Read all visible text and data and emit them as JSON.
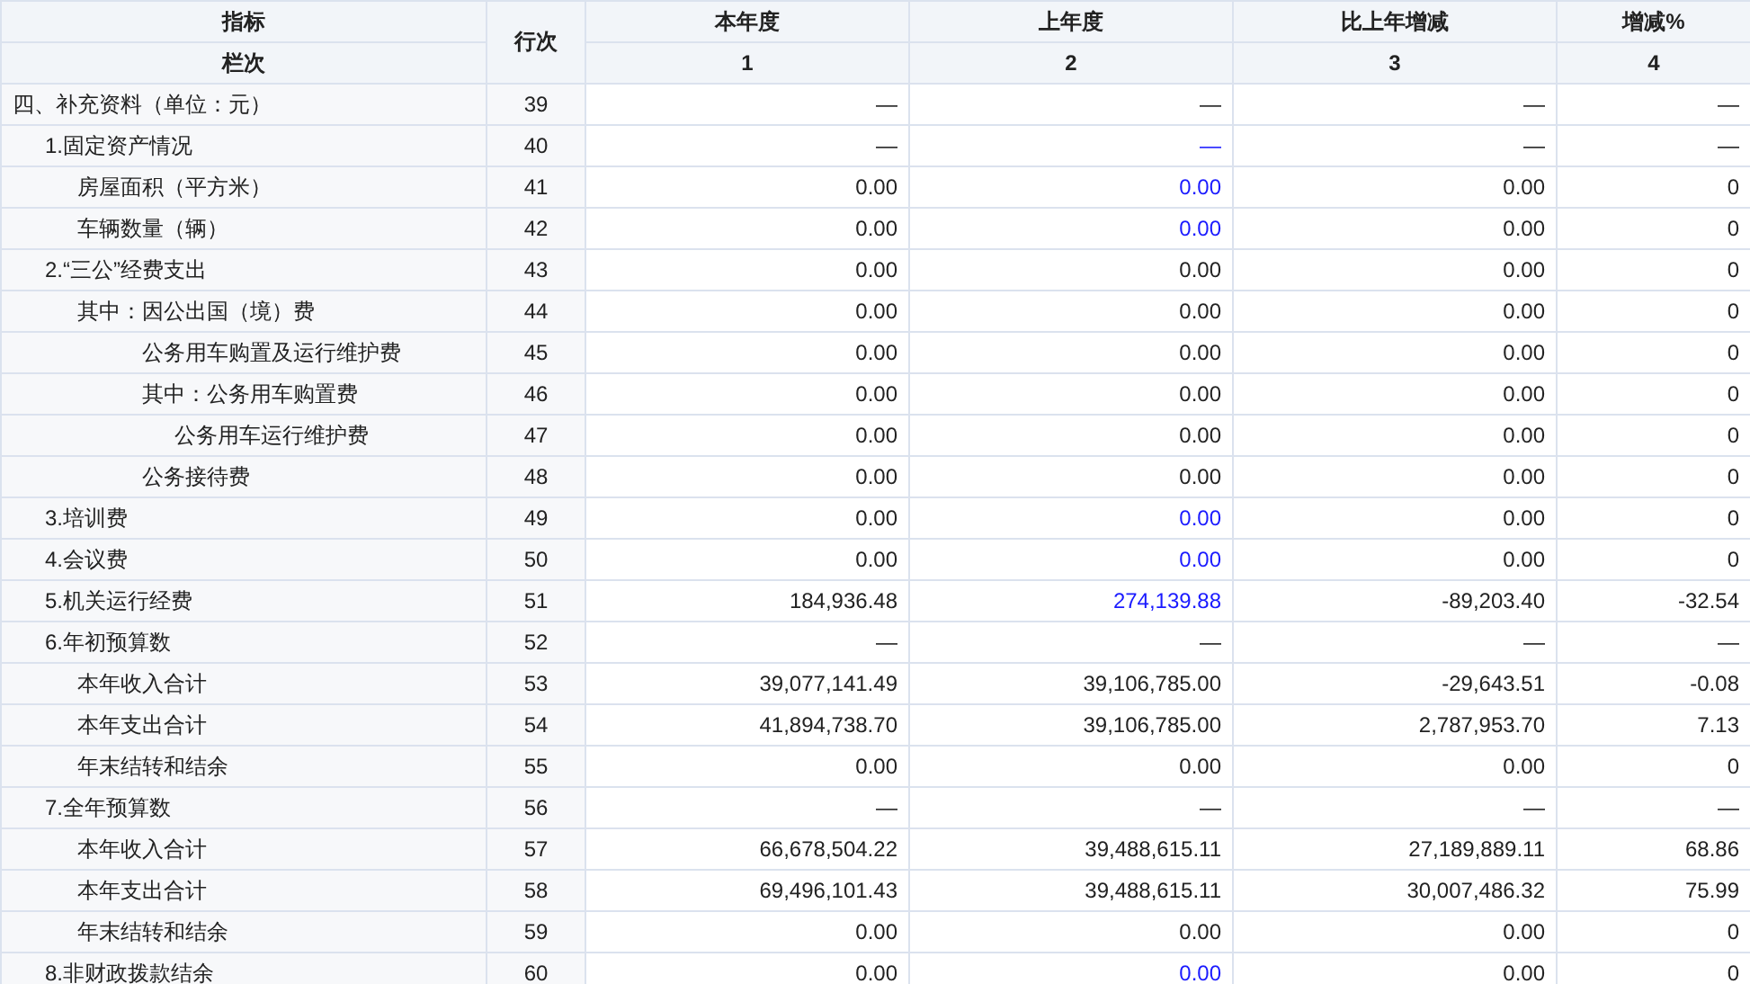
{
  "table": {
    "columns": [
      {
        "title": "指标",
        "code": "栏次"
      },
      {
        "title": "行次"
      },
      {
        "title": "本年度",
        "code": "1"
      },
      {
        "title": "上年度",
        "code": "2"
      },
      {
        "title": "比上年增减",
        "code": "3"
      },
      {
        "title": "增减%",
        "code": "4"
      }
    ],
    "rows": [
      {
        "label": "四、补充资料（单位：元）",
        "line": "39",
        "values": [
          "—",
          "—",
          "—",
          "—"
        ],
        "prior_year_linked": false,
        "children": [
          {
            "label": "1.固定资产情况",
            "line": "40",
            "values": [
              "—",
              "—",
              "—",
              "—"
            ],
            "prior_year_linked": true,
            "children": [
              {
                "label": "房屋面积（平方米）",
                "line": "41",
                "values": [
                  "0.00",
                  "0.00",
                  "0.00",
                  "0"
                ],
                "prior_year_linked": true
              },
              {
                "label": "车辆数量（辆）",
                "line": "42",
                "values": [
                  "0.00",
                  "0.00",
                  "0.00",
                  "0"
                ],
                "prior_year_linked": true
              }
            ]
          },
          {
            "label": "2.“三公”经费支出",
            "line": "43",
            "values": [
              "0.00",
              "0.00",
              "0.00",
              "0"
            ],
            "prior_year_linked": false,
            "children": [
              {
                "label": "其中：因公出国（境）费",
                "line": "44",
                "values": [
                  "0.00",
                  "0.00",
                  "0.00",
                  "0"
                ],
                "prior_year_linked": false,
                "children": [
                  {
                    "label": "公务用车购置及运行维护费",
                    "line": "45",
                    "values": [
                      "0.00",
                      "0.00",
                      "0.00",
                      "0"
                    ],
                    "prior_year_linked": false
                  },
                  {
                    "label": "其中：公务用车购置费",
                    "line": "46",
                    "values": [
                      "0.00",
                      "0.00",
                      "0.00",
                      "0"
                    ],
                    "prior_year_linked": false,
                    "children": [
                      {
                        "label": "公务用车运行维护费",
                        "line": "47",
                        "values": [
                          "0.00",
                          "0.00",
                          "0.00",
                          "0"
                        ],
                        "prior_year_linked": false
                      }
                    ]
                  },
                  {
                    "label": "公务接待费",
                    "line": "48",
                    "values": [
                      "0.00",
                      "0.00",
                      "0.00",
                      "0"
                    ],
                    "prior_year_linked": false
                  }
                ]
              }
            ]
          },
          {
            "label": "3.培训费",
            "line": "49",
            "values": [
              "0.00",
              "0.00",
              "0.00",
              "0"
            ],
            "prior_year_linked": true
          },
          {
            "label": "4.会议费",
            "line": "50",
            "values": [
              "0.00",
              "0.00",
              "0.00",
              "0"
            ],
            "prior_year_linked": true
          },
          {
            "label": "5.机关运行经费",
            "line": "51",
            "values": [
              "184,936.48",
              "274,139.88",
              "-89,203.40",
              "-32.54"
            ],
            "prior_year_linked": true
          },
          {
            "label": "6.年初预算数",
            "line": "52",
            "values": [
              "—",
              "—",
              "—",
              "—"
            ],
            "prior_year_linked": false,
            "children": [
              {
                "label": "本年收入合计",
                "line": "53",
                "values": [
                  "39,077,141.49",
                  "39,106,785.00",
                  "-29,643.51",
                  "-0.08"
                ],
                "prior_year_linked": false
              },
              {
                "label": "本年支出合计",
                "line": "54",
                "values": [
                  "41,894,738.70",
                  "39,106,785.00",
                  "2,787,953.70",
                  "7.13"
                ],
                "prior_year_linked": false
              },
              {
                "label": "年末结转和结余",
                "line": "55",
                "values": [
                  "0.00",
                  "0.00",
                  "0.00",
                  "0"
                ],
                "prior_year_linked": false
              }
            ]
          },
          {
            "label": "7.全年预算数",
            "line": "56",
            "values": [
              "—",
              "—",
              "—",
              "—"
            ],
            "prior_year_linked": false,
            "children": [
              {
                "label": "本年收入合计",
                "line": "57",
                "values": [
                  "66,678,504.22",
                  "39,488,615.11",
                  "27,189,889.11",
                  "68.86"
                ],
                "prior_year_linked": false
              },
              {
                "label": "本年支出合计",
                "line": "58",
                "values": [
                  "69,496,101.43",
                  "39,488,615.11",
                  "30,007,486.32",
                  "75.99"
                ],
                "prior_year_linked": false
              },
              {
                "label": "年末结转和结余",
                "line": "59",
                "values": [
                  "0.00",
                  "0.00",
                  "0.00",
                  "0"
                ],
                "prior_year_linked": false
              }
            ]
          },
          {
            "label": "8.非财政拨款结余",
            "line": "60",
            "values": [
              "0.00",
              "0.00",
              "0.00",
              "0"
            ],
            "prior_year_linked": true
          }
        ]
      }
    ]
  }
}
